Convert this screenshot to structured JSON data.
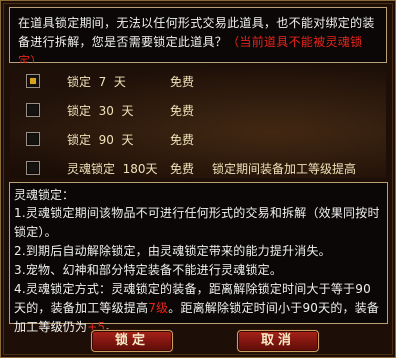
{
  "notice": {
    "text": "在道具锁定期间，无法以任何形式交易此道具，也不能对绑定的装备进行拆解，您是否需要锁定此道具？",
    "warning": "（当前道具不能被灵魂锁定）"
  },
  "options": [
    {
      "label": "锁定  7  天",
      "fee": "免费",
      "note": "",
      "checked": true
    },
    {
      "label": "锁定  30  天",
      "fee": "免费",
      "note": "",
      "checked": false
    },
    {
      "label": "锁定  90  天",
      "fee": "免费",
      "note": "",
      "checked": false
    },
    {
      "label": "灵魂锁定  180天",
      "fee": "免费",
      "note": "锁定期间装备加工等级提高",
      "checked": false
    }
  ],
  "description": {
    "title": "灵魂锁定：",
    "items": [
      {
        "pre": "1.灵魂锁定期间该物品不可进行任何形式的交易和拆解（效果同按时锁定）。"
      },
      {
        "pre": "2.到期后自动解除锁定，由灵魂锁定带来的能力提升消失。"
      },
      {
        "pre": "3.宠物、幻神和部分特定装备不能进行灵魂锁定。"
      },
      {
        "pre": "4.灵魂锁定方式：灵魂锁定的装备，距离解除锁定时间大于等于90天的，装备加工等级提高",
        "hl1": "7级",
        "mid": "。距离解除锁定时间小于90天的，装备加工等级仍为",
        "hl2": "+5",
        "post": "。"
      }
    ]
  },
  "buttons": {
    "lock": "锁定",
    "cancel": "取消"
  },
  "colors": {
    "warning": "#e8231a",
    "button": "#7e150f",
    "border": "#b9a074"
  }
}
